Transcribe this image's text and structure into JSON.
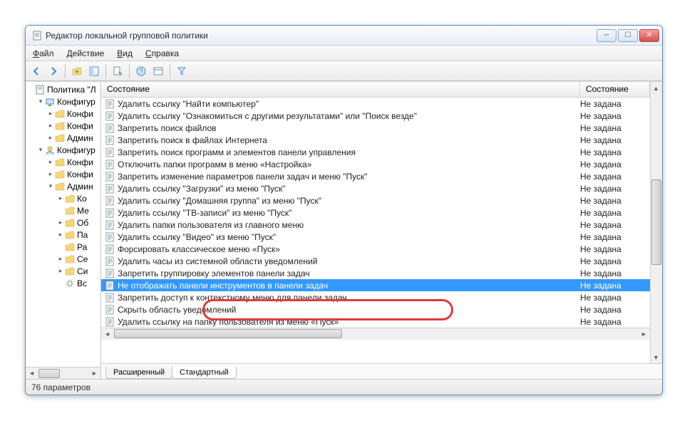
{
  "window": {
    "title": "Редактор локальной групповой политики"
  },
  "menu": {
    "file": "Файл",
    "action": "Действие",
    "view": "Вид",
    "help": "Справка"
  },
  "columns": {
    "name": "Состояние",
    "state": "Состояние"
  },
  "state_default": "Не задана",
  "tree": [
    {
      "indent": 0,
      "exp": "",
      "icon": "policy",
      "label": "Политика \"Л"
    },
    {
      "indent": 1,
      "exp": "▾",
      "icon": "computer",
      "label": "Конфигур"
    },
    {
      "indent": 2,
      "exp": "▸",
      "icon": "folder",
      "label": "Конфи"
    },
    {
      "indent": 2,
      "exp": "▸",
      "icon": "folder",
      "label": "Конфи"
    },
    {
      "indent": 2,
      "exp": "▸",
      "icon": "folder",
      "label": "Админ"
    },
    {
      "indent": 1,
      "exp": "▾",
      "icon": "user",
      "label": "Конфигур"
    },
    {
      "indent": 2,
      "exp": "▸",
      "icon": "folder",
      "label": "Конфи"
    },
    {
      "indent": 2,
      "exp": "▸",
      "icon": "folder",
      "label": "Конфи"
    },
    {
      "indent": 2,
      "exp": "▾",
      "icon": "folder",
      "label": "Админ"
    },
    {
      "indent": 3,
      "exp": "▸",
      "icon": "folder",
      "label": "Ко"
    },
    {
      "indent": 3,
      "exp": "",
      "icon": "folder",
      "label": "Ме"
    },
    {
      "indent": 3,
      "exp": "▸",
      "icon": "folder",
      "label": "Об"
    },
    {
      "indent": 3,
      "exp": "▸",
      "icon": "folder",
      "label": "Па"
    },
    {
      "indent": 3,
      "exp": "",
      "icon": "folder",
      "label": "Ра"
    },
    {
      "indent": 3,
      "exp": "▸",
      "icon": "folder",
      "label": "Се"
    },
    {
      "indent": 3,
      "exp": "▸",
      "icon": "folder",
      "label": "Си"
    },
    {
      "indent": 3,
      "exp": "",
      "icon": "settings",
      "label": "Вс"
    }
  ],
  "rows": [
    {
      "name": "Удалить ссылку \"Найти компьютер\"",
      "selected": false
    },
    {
      "name": "Удалить ссылку \"Ознакомиться с другими результатами\" или \"Поиск везде\"",
      "selected": false
    },
    {
      "name": "Запретить поиск файлов",
      "selected": false
    },
    {
      "name": "Запретить поиск в файлах Интернета",
      "selected": false
    },
    {
      "name": "Запретить поиск программ и элементов панели управления",
      "selected": false
    },
    {
      "name": "Отключить папки программ в меню «Настройка»",
      "selected": false
    },
    {
      "name": "Запретить изменение параметров панели задач и меню \"Пуск\"",
      "selected": false
    },
    {
      "name": "Удалить ссылку \"Загрузки\" из меню \"Пуск\"",
      "selected": false
    },
    {
      "name": "Удалить ссылку \"Домашняя группа\" из меню \"Пуск\"",
      "selected": false
    },
    {
      "name": "Удалить ссылку \"ТВ-записи\" из меню \"Пуск\"",
      "selected": false
    },
    {
      "name": "Удалить папки пользователя из главного меню",
      "selected": false
    },
    {
      "name": "Удалить ссылку \"Видео\" из меню \"Пуск\"",
      "selected": false
    },
    {
      "name": "Форсировать классическое меню «Пуск»",
      "selected": false
    },
    {
      "name": "Удалить часы из системной области уведомлений",
      "selected": false
    },
    {
      "name": "Запретить группировку элементов панели задач",
      "selected": false
    },
    {
      "name": "Не отображать панели инструментов в панели задач",
      "selected": true
    },
    {
      "name": "Запретить доступ к контекстному меню для панели задач",
      "selected": false
    },
    {
      "name": "Скрыть область уведомлений",
      "selected": false
    },
    {
      "name": "Удалить ссылку на папку пользователя из меню «Пуск»",
      "selected": false
    }
  ],
  "tabs": {
    "extended": "Расширенный",
    "standard": "Стандартный"
  },
  "status": "76 параметров"
}
